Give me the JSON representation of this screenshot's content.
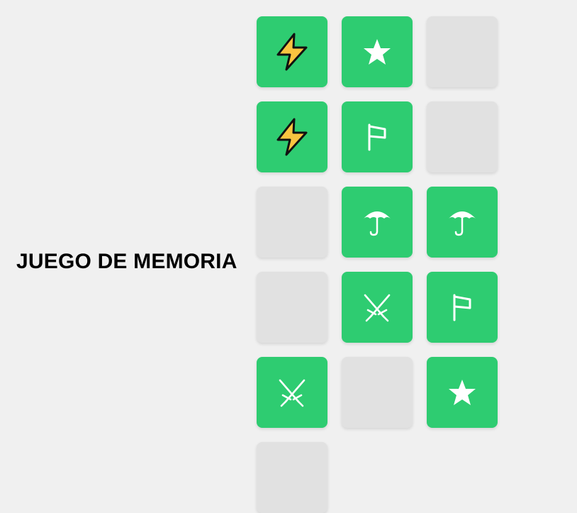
{
  "game": {
    "title": "JUEGO DE MEMORIA"
  },
  "colors": {
    "background": "#f0f0f0",
    "card_revealed": "#2ecc71",
    "card_hidden": "#e1e1e1",
    "bolt_fill": "#f9c440",
    "symbol": "#ffffff"
  },
  "board": {
    "columns": 3,
    "cards": [
      {
        "state": "revealed",
        "icon": "lightning-icon"
      },
      {
        "state": "revealed",
        "icon": "star-icon"
      },
      {
        "state": "hidden",
        "icon": ""
      },
      {
        "state": "revealed",
        "icon": "lightning-icon"
      },
      {
        "state": "revealed",
        "icon": "flag-icon"
      },
      {
        "state": "hidden",
        "icon": ""
      },
      {
        "state": "hidden",
        "icon": ""
      },
      {
        "state": "revealed",
        "icon": "umbrella-icon"
      },
      {
        "state": "revealed",
        "icon": "umbrella-icon"
      },
      {
        "state": "hidden",
        "icon": ""
      },
      {
        "state": "revealed",
        "icon": "crossed-swords-icon"
      },
      {
        "state": "revealed",
        "icon": "flag-icon"
      },
      {
        "state": "revealed",
        "icon": "crossed-swords-icon"
      },
      {
        "state": "hidden",
        "icon": ""
      },
      {
        "state": "revealed",
        "icon": "star-icon"
      },
      {
        "state": "hidden",
        "icon": ""
      }
    ]
  }
}
